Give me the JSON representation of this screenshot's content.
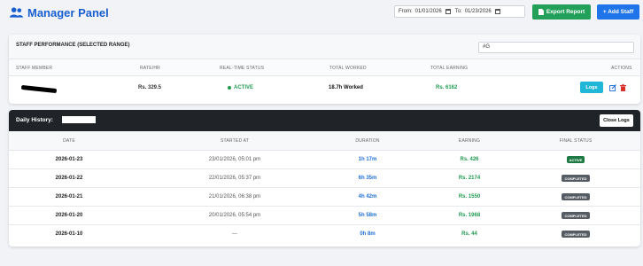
{
  "header": {
    "title": "Manager Panel",
    "from_label": "From:",
    "from_value": "01/01/2026",
    "to_label": "To:",
    "to_value": "01/23/2026",
    "export_label": "Export Report",
    "add_label": "+ Add Staff"
  },
  "performance": {
    "title": "STAFF PERFORMANCE (SELECTED RANGE)",
    "search_value": "#G",
    "columns": [
      "STAFF MEMBER",
      "RATE/HR",
      "REAL-TIME STATUS",
      "TOTAL WORKED",
      "TOTAL EARNING",
      "ACTIONS"
    ],
    "row": {
      "rate": "Rs. 329.5",
      "status": "ACTIVE",
      "worked": "18.7h Worked",
      "earning": "Rs. 6162",
      "logs_label": "Logs"
    }
  },
  "history": {
    "title": "Daily History: ",
    "close_label": "Close Logs",
    "columns": [
      "DATE",
      "STARTED AT",
      "DURATION",
      "EARNING",
      "FINAL STATUS"
    ],
    "rows": [
      {
        "date": "2026-01-23",
        "started": "23/01/2026, 05:01 pm",
        "duration": "1h 17m",
        "earning": "Rs. 426",
        "status": "ACTIVE"
      },
      {
        "date": "2026-01-22",
        "started": "22/01/2026, 05:37 pm",
        "duration": "6h 35m",
        "earning": "Rs. 2174",
        "status": "COMPLETED"
      },
      {
        "date": "2026-01-21",
        "started": "21/01/2026, 06:38 pm",
        "duration": "4h 42m",
        "earning": "Rs. 1550",
        "status": "COMPLETED"
      },
      {
        "date": "2026-01-20",
        "started": "20/01/2026, 05:54 pm",
        "duration": "5h 58m",
        "earning": "Rs. 1968",
        "status": "COMPLETED"
      },
      {
        "date": "2026-01-10",
        "started": "---",
        "duration": "0h 8m",
        "earning": "Rs. 44",
        "status": "COMPLETED"
      }
    ]
  },
  "colors": {
    "brand": "#1a5fd0",
    "export": "#22a05a",
    "add": "#1e74e8",
    "active": "#1f9a4f",
    "duration": "#1e6fd9",
    "dark_header": "#202327"
  }
}
